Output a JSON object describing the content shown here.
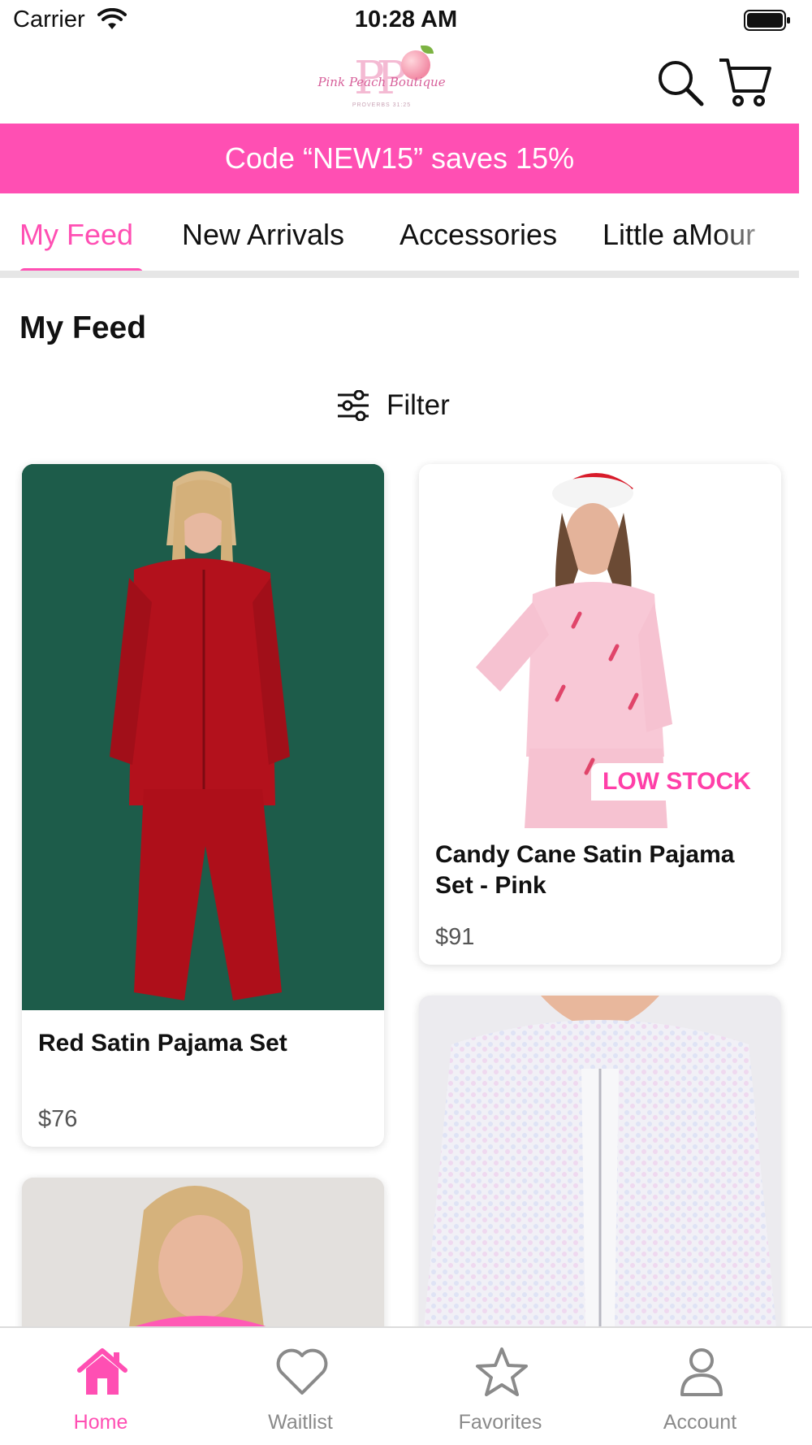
{
  "status_bar": {
    "carrier": "Carrier",
    "time": "10:28 AM"
  },
  "header": {
    "logo_text": "Pink Peach Boutique",
    "logo_monogram": "PP",
    "logo_subtext": "PROVERBS 31:25"
  },
  "promo": {
    "text": "Code “NEW15” saves 15%"
  },
  "tabs": [
    {
      "label": "My Feed",
      "active": true
    },
    {
      "label": "New Arrivals",
      "active": false
    },
    {
      "label": "Accessories",
      "active": false
    },
    {
      "label": "Little aMour",
      "active": false
    }
  ],
  "feed": {
    "title": "My Feed",
    "filter_label": "Filter",
    "products": [
      {
        "name": "Red Satin Pajama Set",
        "price": "$76",
        "badge": ""
      },
      {
        "name": "Candy Cane Satin Pajama Set - Pink",
        "price": "$91",
        "badge": "LOW STOCK"
      },
      {
        "name": "",
        "price": "",
        "badge": ""
      },
      {
        "name": "",
        "price": "",
        "badge": ""
      }
    ]
  },
  "bottom_nav": [
    {
      "label": "Home",
      "icon": "home-icon",
      "active": true
    },
    {
      "label": "Waitlist",
      "icon": "heart-icon",
      "active": false
    },
    {
      "label": "Favorites",
      "icon": "star-icon",
      "active": false
    },
    {
      "label": "Account",
      "icon": "person-icon",
      "active": false
    }
  ],
  "colors": {
    "accent": "#ff4fb3",
    "inactive": "#8a8a8a"
  }
}
